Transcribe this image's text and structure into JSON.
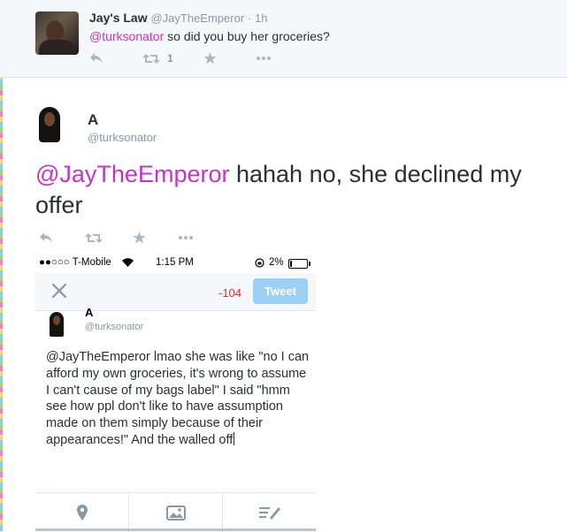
{
  "reply_tweet": {
    "name": "Jay's Law",
    "handle": "@JayTheEmperor",
    "time": "· 1h",
    "mention": "@turksonator",
    "text": " so did you buy her groceries?",
    "retweet_count": "1"
  },
  "main_tweet": {
    "name": "A",
    "handle": "@turksonator",
    "mention": "@JayTheEmperor",
    "text": " hahah no, she declined my offer"
  },
  "embedded_screenshot": {
    "status_bar": {
      "carrier": "●●○○○ T-Mobile",
      "time": "1:15 PM",
      "battery": "2%"
    },
    "compose": {
      "char_count": "-104",
      "tweet_button": "Tweet"
    },
    "profile": {
      "name": "A",
      "handle": "@turksonator"
    },
    "draft_text": "@JayTheEmperor lmao she was like \"no I can afford my own groceries, it's wrong to assume I can't cause of my bags label\" I said \"hmm see how ppl don't like to have assumption made on them simply because of their appearances!\" And the walled off"
  },
  "colors": {
    "mention": "#c534c8",
    "action_icon": "#aab8c2",
    "tweet_button": "#9dd0f5",
    "negative_count": "#e02d2d"
  },
  "icons": [
    "reply-icon",
    "retweet-icon",
    "favorite-icon",
    "more-icon",
    "close-icon",
    "wifi-icon",
    "location-icon",
    "photo-icon",
    "compose-icon"
  ]
}
